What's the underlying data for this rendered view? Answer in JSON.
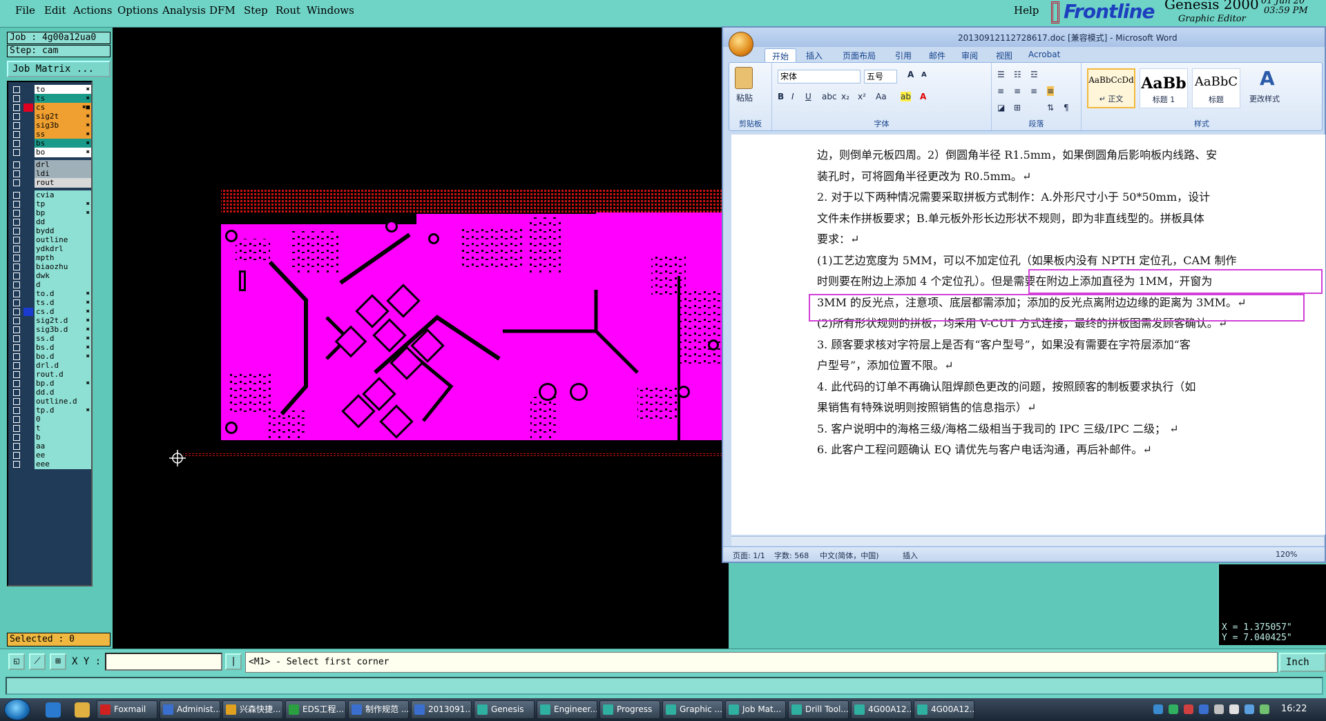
{
  "menubar": {
    "left_items": [
      "File",
      "Edit",
      "Actions",
      "Options",
      "Analysis",
      "DFM",
      "Step",
      "Rout",
      "Windows"
    ],
    "help": "Help"
  },
  "brand": {
    "logo_text": "Frontline",
    "product": "Genesis 2000",
    "subtitle": "Graphic Editor",
    "date": "01 Jun 20",
    "time": "03:59 PM"
  },
  "job_panel": {
    "job": "Job : 4g00a12ua0",
    "step": "Step: cam",
    "matrix_button": "Job Matrix ...",
    "selected": "Selected : 0"
  },
  "layers": {
    "group1": [
      {
        "name": "to",
        "color": "#ffffff",
        "swatch": "",
        "flag": "✖"
      },
      {
        "name": "ts",
        "color": "#1a9b8a",
        "swatch": "",
        "flag": "✖"
      },
      {
        "name": "cs",
        "color": "#f0a030",
        "swatch": "#e00020",
        "flag": "✖■"
      },
      {
        "name": "sig2t",
        "color": "#f0a030",
        "swatch": "",
        "flag": "✖"
      },
      {
        "name": "sig3b",
        "color": "#f0a030",
        "swatch": "",
        "flag": "✖"
      },
      {
        "name": "ss",
        "color": "#f0a030",
        "swatch": "",
        "flag": "✖"
      },
      {
        "name": "bs",
        "color": "#1a9b8a",
        "swatch": "",
        "flag": "✖"
      },
      {
        "name": "bo",
        "color": "#ffffff",
        "swatch": "",
        "flag": "✖"
      }
    ],
    "group2": [
      {
        "name": "drl",
        "color": "#9fb0b8",
        "swatch": "",
        "flag": ""
      },
      {
        "name": "ldi",
        "color": "#9fb0b8",
        "swatch": "",
        "flag": ""
      },
      {
        "name": "rout",
        "color": "#d8d8d8",
        "swatch": "",
        "flag": ""
      }
    ],
    "group3": [
      {
        "name": "cvia",
        "color": "#8fe0d4",
        "swatch": "",
        "flag": ""
      },
      {
        "name": "tp",
        "color": "#8fe0d4",
        "swatch": "",
        "flag": "✖"
      },
      {
        "name": "bp",
        "color": "#8fe0d4",
        "swatch": "",
        "flag": "✖"
      },
      {
        "name": "dd",
        "color": "#8fe0d4",
        "swatch": "",
        "flag": ""
      },
      {
        "name": "bydd",
        "color": "#8fe0d4",
        "swatch": "",
        "flag": ""
      },
      {
        "name": "outline",
        "color": "#8fe0d4",
        "swatch": "",
        "flag": ""
      },
      {
        "name": "ydkdrl",
        "color": "#8fe0d4",
        "swatch": "",
        "flag": ""
      },
      {
        "name": "mpth",
        "color": "#8fe0d4",
        "swatch": "",
        "flag": ""
      },
      {
        "name": "biaozhu",
        "color": "#8fe0d4",
        "swatch": "",
        "flag": ""
      },
      {
        "name": "dwk",
        "color": "#8fe0d4",
        "swatch": "",
        "flag": ""
      },
      {
        "name": "d",
        "color": "#8fe0d4",
        "swatch": "",
        "flag": ""
      },
      {
        "name": "to.d",
        "color": "#8fe0d4",
        "swatch": "",
        "flag": "✖"
      },
      {
        "name": "ts.d",
        "color": "#8fe0d4",
        "swatch": "",
        "flag": "✖"
      },
      {
        "name": "cs.d",
        "color": "#8fe0d4",
        "swatch": "#1a3ad0",
        "flag": "✖"
      },
      {
        "name": "sig2t.d",
        "color": "#8fe0d4",
        "swatch": "",
        "flag": "✖"
      },
      {
        "name": "sig3b.d",
        "color": "#8fe0d4",
        "swatch": "",
        "flag": "✖"
      },
      {
        "name": "ss.d",
        "color": "#8fe0d4",
        "swatch": "",
        "flag": "✖"
      },
      {
        "name": "bs.d",
        "color": "#8fe0d4",
        "swatch": "",
        "flag": "✖"
      },
      {
        "name": "bo.d",
        "color": "#8fe0d4",
        "swatch": "",
        "flag": "✖"
      },
      {
        "name": "drl.d",
        "color": "#8fe0d4",
        "swatch": "",
        "flag": ""
      },
      {
        "name": "rout.d",
        "color": "#8fe0d4",
        "swatch": "",
        "flag": ""
      },
      {
        "name": "bp.d",
        "color": "#8fe0d4",
        "swatch": "",
        "flag": "✖"
      },
      {
        "name": "dd.d",
        "color": "#8fe0d4",
        "swatch": "",
        "flag": ""
      },
      {
        "name": "outline.d",
        "color": "#8fe0d4",
        "swatch": "",
        "flag": ""
      },
      {
        "name": "tp.d",
        "color": "#8fe0d4",
        "swatch": "",
        "flag": "✖"
      },
      {
        "name": "0",
        "color": "#8fe0d4",
        "swatch": "",
        "flag": ""
      },
      {
        "name": "t",
        "color": "#8fe0d4",
        "swatch": "",
        "flag": ""
      },
      {
        "name": "b",
        "color": "#8fe0d4",
        "swatch": "",
        "flag": ""
      },
      {
        "name": "aa",
        "color": "#8fe0d4",
        "swatch": "",
        "flag": ""
      },
      {
        "name": "ee",
        "color": "#8fe0d4",
        "swatch": "",
        "flag": ""
      },
      {
        "name": "eee",
        "color": "#8fe0d4",
        "swatch": "",
        "flag": ""
      }
    ]
  },
  "word": {
    "title": "20130912112728617.doc [兼容模式] - Microsoft Word",
    "tabs": [
      "开始",
      "插入",
      "页面布局",
      "引用",
      "邮件",
      "审阅",
      "视图",
      "Acrobat"
    ],
    "active_tab": "开始",
    "font_name": "宋体",
    "font_size": "五号",
    "paste_label": "粘贴",
    "change_styles_label": "更改样式",
    "groups": [
      "剪贴板",
      "字体",
      "段落",
      "样式"
    ],
    "styles": [
      {
        "sample": "AaBbCcDd",
        "name": "↵ 正文"
      },
      {
        "sample": "AaBb",
        "name": "标题 1"
      },
      {
        "sample": "AaBbC",
        "name": "标题"
      }
    ],
    "doc_lines": [
      "边，则倒单元板四周。2）倒圆角半径 R1.5mm，如果倒圆角后影响板内线路、安",
      "装孔时，可将圆角半径更改为 R0.5mm。↵",
      "2.  对于以下两种情况需要采取拼板方式制作：A.外形尺寸小于  50*50mm，设计",
      "文件未作拼板要求；B.单元板外形长边形状不规则，即为非直线型的。拼板具体",
      "要求：↵",
      "(1)工艺边宽度为 5MM，可以不加定位孔（如果板内没有 NPTH 定位孔，CAM 制作",
      "时则要在附边上添加 4 个定位孔）。但是需要在附边上添加直径为 1MM，开窗为",
      "3MM 的反光点，注意项、底层都需添加；添加的反光点离附边边缘的距离为 3MM。↵",
      "(2)所有形状规则的拼板，均采用 V-CUT 方式连接，最终的拼板图需发顾客确认。↵",
      "3.  顾客要求核对字符层上是否有“客户型号”，如果没有需要在字符层添加“客",
      "户型号”，添加位置不限。↵",
      "4.  此代码的订单不再确认阻焊颜色更改的问题，按照顾客的制板要求执行（如",
      "果销售有特殊说明则按照销售的信息指示）↵",
      "5.  客户说明中的海格三级/海格二级相当于我司的 IPC 三级/IPC 二级；  ↵",
      "6.  此客户工程问题确认 EQ 请优先与客户电话沟通，再后补邮件。↵"
    ],
    "status": {
      "page": "页面: 1/1",
      "words": "字数: 568",
      "lang": "中文(简体，中国)",
      "mode": "插入",
      "zoom": "120%"
    }
  },
  "coords": {
    "x": "X = 1.375057\"",
    "y": "Y = 7.040425\""
  },
  "command": {
    "xy_label": "X Y :",
    "xy_value": "",
    "prompt": "<M1> - Select first corner",
    "units": "Inch"
  },
  "taskbar": {
    "items": [
      {
        "label": "Foxmail",
        "color": "#d02020"
      },
      {
        "label": "Administ...",
        "color": "#3a6fd0"
      },
      {
        "label": "兴森快捷...",
        "color": "#e0a020"
      },
      {
        "label": "EDS工程...",
        "color": "#2aa040"
      },
      {
        "label": "制作规范 ...",
        "color": "#3a6fd0"
      },
      {
        "label": "2013091...",
        "color": "#3a6fd0"
      },
      {
        "label": "Genesis",
        "color": "#30b0a0"
      },
      {
        "label": "Engineer...",
        "color": "#30b0a0"
      },
      {
        "label": "Progress",
        "color": "#30b0a0"
      },
      {
        "label": "Graphic ...",
        "color": "#30b0a0"
      },
      {
        "label": "Job Mat...",
        "color": "#30b0a0"
      },
      {
        "label": "Drill Tool...",
        "color": "#30b0a0"
      },
      {
        "label": "4G00A12...",
        "color": "#30b0a0"
      },
      {
        "label": "4G00A12...",
        "color": "#30b0a0"
      }
    ],
    "time": "16:22"
  },
  "colors": {
    "pcb_copper": "#ff00ff",
    "pcb_frame": "#cc1010",
    "highlight_box": "#d23fd9"
  }
}
